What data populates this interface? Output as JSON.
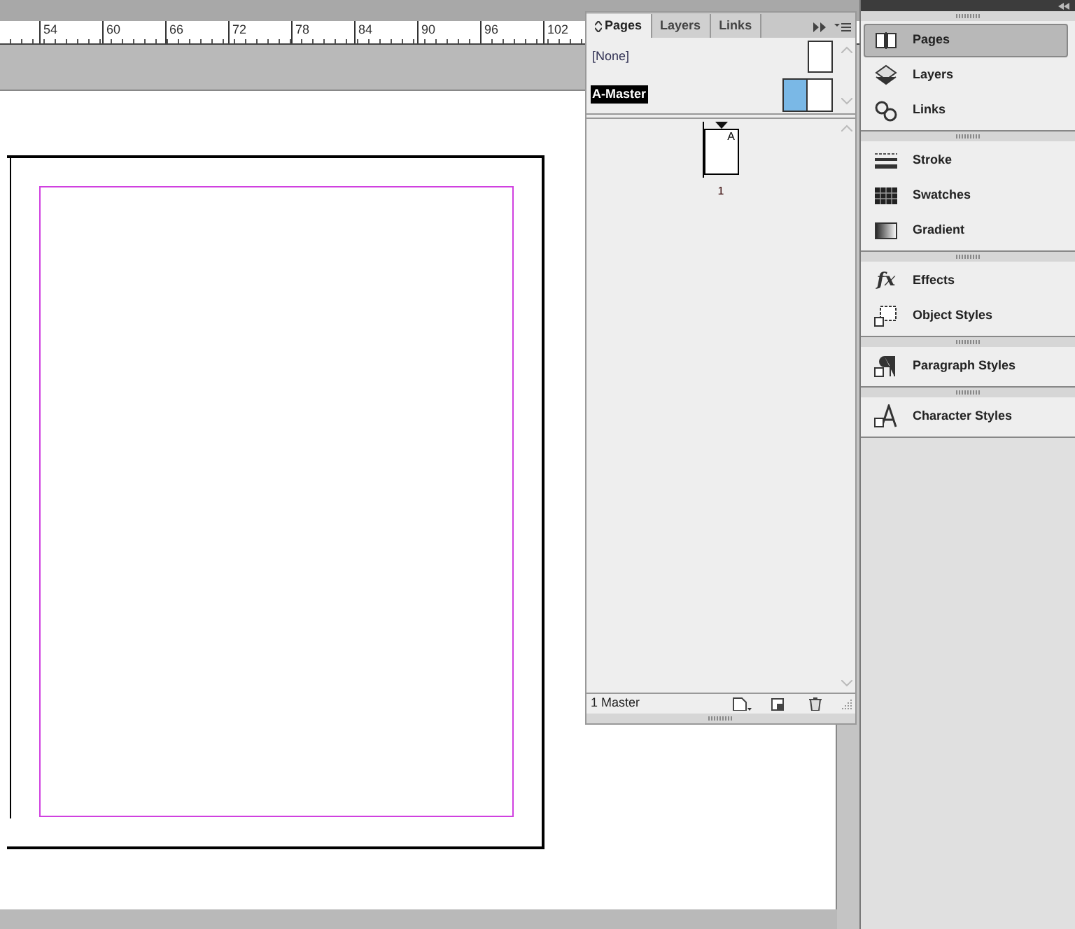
{
  "ruler": {
    "labels": [
      "54",
      "60",
      "66",
      "72",
      "78",
      "84",
      "90",
      "96",
      "102"
    ]
  },
  "pages_panel": {
    "tabs": [
      {
        "label": "Pages",
        "selected": true
      },
      {
        "label": "Layers",
        "selected": false
      },
      {
        "label": "Links",
        "selected": false
      }
    ],
    "masters": [
      {
        "label": "[None]",
        "selected": false,
        "kind": "none"
      },
      {
        "label": "A-Master",
        "selected": true,
        "kind": "spread"
      }
    ],
    "page": {
      "prefix": "A",
      "number": "1"
    },
    "footer": "1 Master"
  },
  "dock": {
    "groups": [
      [
        {
          "label": "Pages",
          "kind": "pages",
          "selected": true
        },
        {
          "label": "Layers",
          "kind": "layers",
          "selected": false
        },
        {
          "label": "Links",
          "kind": "links",
          "selected": false
        }
      ],
      [
        {
          "label": "Stroke",
          "kind": "stroke",
          "selected": false
        },
        {
          "label": "Swatches",
          "kind": "swatches",
          "selected": false
        },
        {
          "label": "Gradient",
          "kind": "gradient",
          "selected": false
        }
      ],
      [
        {
          "label": "Effects",
          "kind": "effects",
          "glyph": "fx",
          "selected": false
        },
        {
          "label": "Object Styles",
          "kind": "object",
          "selected": false
        }
      ],
      [
        {
          "label": "Paragraph Styles",
          "kind": "paragraph",
          "selected": false
        }
      ],
      [
        {
          "label": "Character Styles",
          "kind": "character",
          "selected": false
        }
      ]
    ]
  }
}
